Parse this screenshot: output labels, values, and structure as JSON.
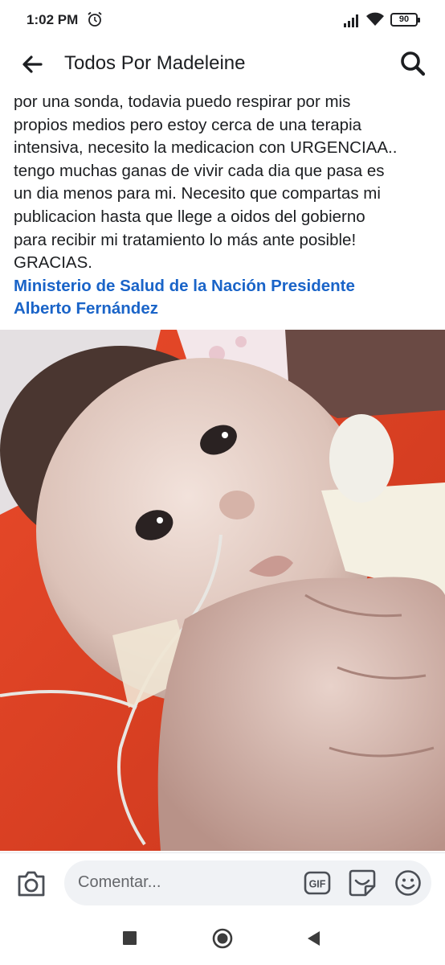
{
  "status_bar": {
    "time": "1:02 PM",
    "battery": "90",
    "icons": [
      "alarm-icon",
      "signal-icon",
      "wifi-icon",
      "battery-icon"
    ]
  },
  "header": {
    "title": "Todos Por Madeleine",
    "back_icon": "arrow-left-icon",
    "search_icon": "search-icon"
  },
  "post": {
    "lines": [
      "por una sonda, todavia puedo respirar por mis",
      "propios medios pero estoy cerca  de una terapia",
      "intensiva, necesito la medicacion con URGENCIAA..",
      "tengo muchas ganas de vivir cada dia que pasa es",
      "un dia menos para mi. Necesito que compartas mi",
      "publicacion hasta que llege a oidos del gobierno",
      "para recibir mi tratamiento lo más ante posible!",
      "GRACIAS."
    ],
    "mentions": [
      "Ministerio de Salud de la Nación Presidente",
      "Alberto Fernández"
    ],
    "photo": "photo of a baby with a nasal feeding tube"
  },
  "comment_bar": {
    "placeholder": "Comentar...",
    "gif_label": "GIF",
    "icons": [
      "camera-icon",
      "gif-icon",
      "sticker-icon",
      "emoji-icon"
    ]
  },
  "nav_bar": {
    "icons": [
      "recent-apps-icon",
      "home-icon",
      "back-icon"
    ]
  },
  "colors": {
    "mention": "#1a64c8",
    "text": "#1c1e21",
    "input_bg": "#f0f2f5",
    "photo_background": "#f04a24"
  }
}
